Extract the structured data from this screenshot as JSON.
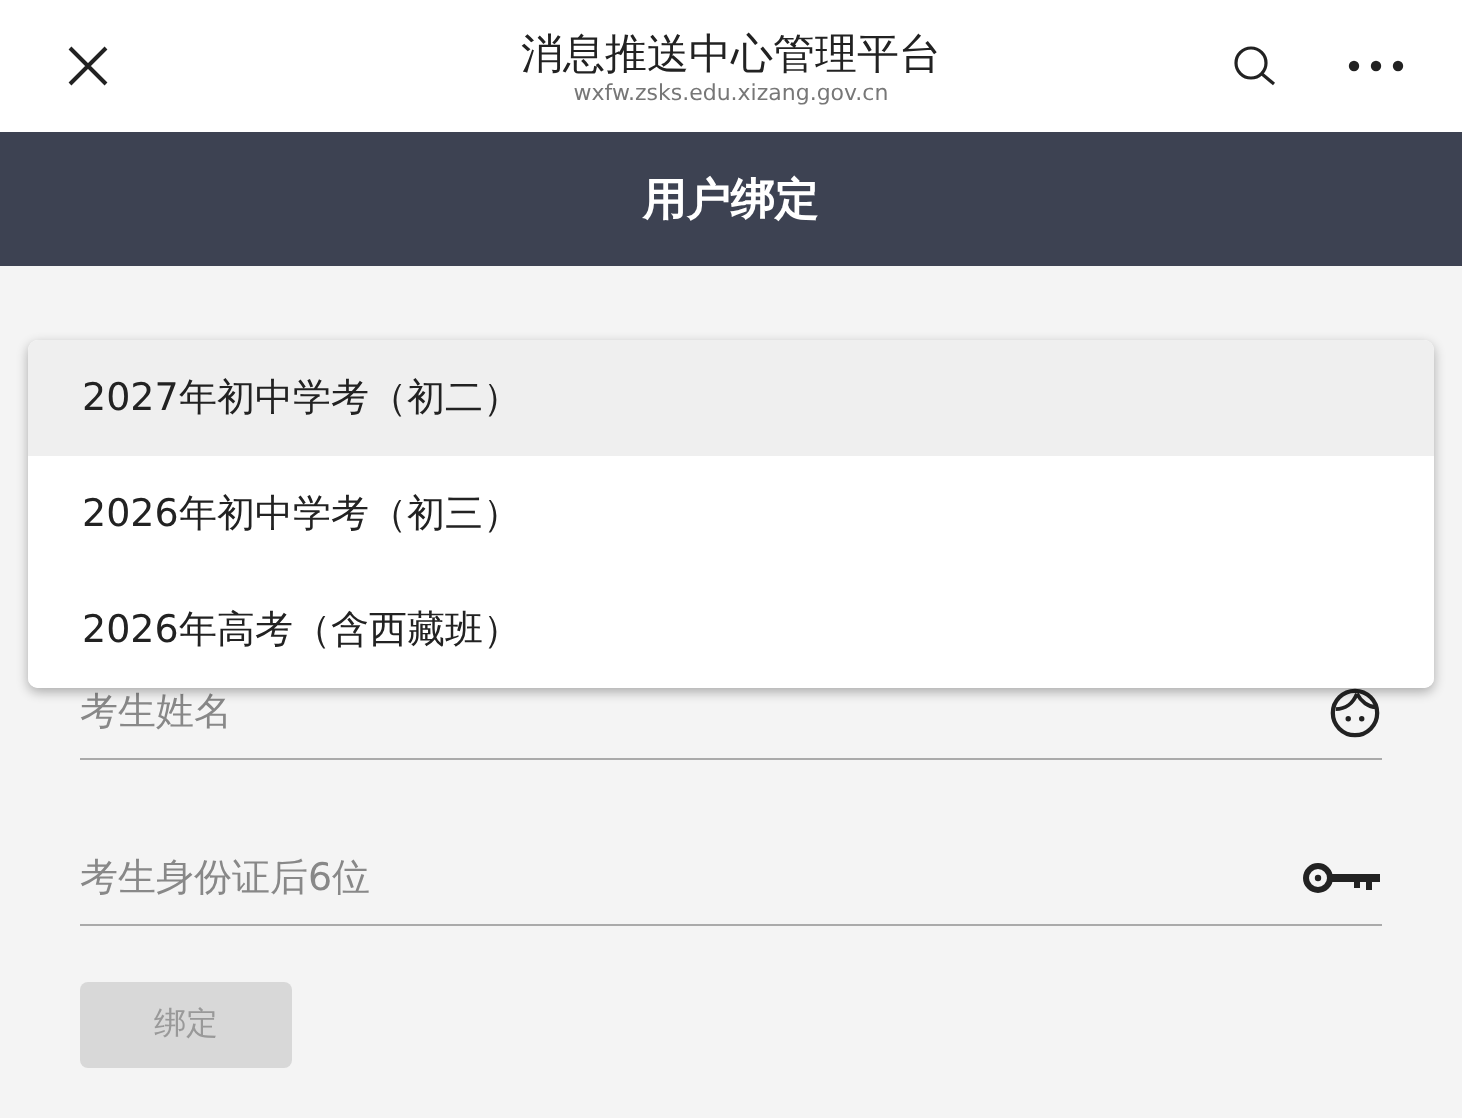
{
  "top_bar": {
    "title": "消息推送中心管理平台",
    "url": "wxfw.zsks.edu.xizang.gov.cn"
  },
  "header": {
    "title": "用户绑定"
  },
  "dropdown": {
    "options": [
      {
        "label": "2027年初中学考（初二）",
        "selected": true
      },
      {
        "label": "2026年初中学考（初三）",
        "selected": false
      },
      {
        "label": "2026年高考（含西藏班）",
        "selected": false
      }
    ]
  },
  "fields": [
    {
      "kind": "name",
      "placeholder": "考生姓名"
    },
    {
      "kind": "id",
      "placeholder": "考生身份证后6位"
    }
  ],
  "bind_button": {
    "label": "绑定",
    "disabled": true
  }
}
